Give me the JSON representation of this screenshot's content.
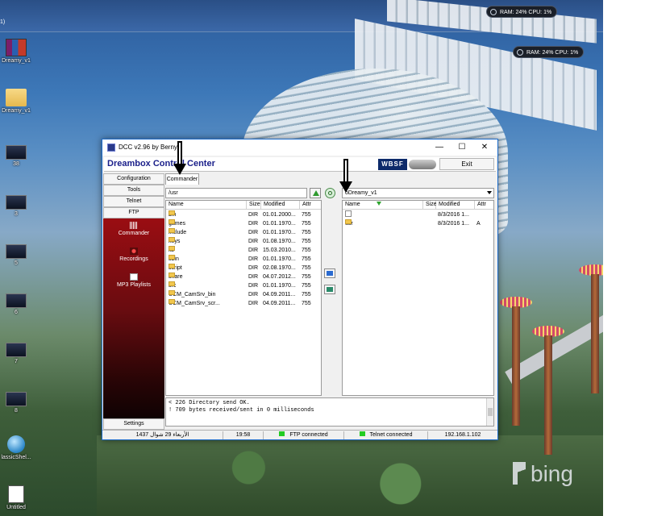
{
  "desktop": {
    "sysmon": [
      {
        "text": "RAM: 24%   CPU: 1%"
      },
      {
        "text": "RAM: 24%   CPU: 1%"
      }
    ],
    "icons": [
      {
        "label": "Dreamy_v1",
        "icon": "winrar-archive-icon"
      },
      {
        "label": "Dreamy_v1",
        "icon": "folder-icon"
      },
      {
        "label": "38",
        "icon": "screenshot-icon"
      },
      {
        "label": "3",
        "icon": "screenshot-icon"
      },
      {
        "label": "5",
        "icon": "screenshot-icon"
      },
      {
        "label": "6",
        "icon": "screenshot-icon"
      },
      {
        "label": "7",
        "icon": "screenshot-icon"
      },
      {
        "label": "8",
        "icon": "screenshot-icon"
      },
      {
        "label": "lassicShel...",
        "icon": "classic-shell-icon"
      },
      {
        "label": "Untitled",
        "icon": "document-icon"
      }
    ],
    "top_left_fragment": "1)",
    "watermark": "bing"
  },
  "window": {
    "title": "DCC v2.96 by BernyR",
    "banner_title": "Dreambox Control Center",
    "wbsf_logo": "WBSF",
    "exit_label": "Exit",
    "sidebar": {
      "buttons": [
        "Configuration",
        "Tools",
        "Telnet",
        "FTP"
      ],
      "items": [
        {
          "label": "Commander",
          "icon": "commander-icon"
        },
        {
          "label": "Recordings",
          "icon": "recordings-icon"
        },
        {
          "label": "MP3 Playlists",
          "icon": "mp3-playlist-icon"
        }
      ],
      "settings_label": "Settings"
    },
    "tab_label": "Commander",
    "left_pane": {
      "path": "/usr",
      "columns": [
        "Name",
        "Size",
        "Modified",
        "Attr"
      ],
      "rows": [
        {
          "name": "bin",
          "size": "DIR",
          "modified": "01.01.2000...",
          "attr": "755"
        },
        {
          "name": "games",
          "size": "DIR",
          "modified": "01.01.1970...",
          "attr": "755"
        },
        {
          "name": "include",
          "size": "DIR",
          "modified": "01.01.1970...",
          "attr": "755"
        },
        {
          "name": "keys",
          "size": "DIR",
          "modified": "01.08.1970...",
          "attr": "755"
        },
        {
          "name": "lib",
          "size": "DIR",
          "modified": "15.03.2010...",
          "attr": "755"
        },
        {
          "name": "sbin",
          "size": "DIR",
          "modified": "01.01.1970...",
          "attr": "755"
        },
        {
          "name": "script",
          "size": "DIR",
          "modified": "02.08.1970...",
          "attr": "755"
        },
        {
          "name": "share",
          "size": "DIR",
          "modified": "04.07.2012...",
          "attr": "755"
        },
        {
          "name": "src",
          "size": "DIR",
          "modified": "01.01.1970...",
          "attr": "755"
        },
        {
          "name": "UCM_CamSrv_bin",
          "size": "DIR",
          "modified": "04.09.2011...",
          "attr": "755"
        },
        {
          "name": "UCM_CamSrv_scr...",
          "size": "DIR",
          "modified": "04.09.2011...",
          "attr": "755"
        }
      ]
    },
    "right_pane": {
      "path": "oDreamy_v1",
      "columns": [
        "Name",
        "Size",
        "Modified",
        "Attr"
      ],
      "rows": [
        {
          "name": "..",
          "size": "",
          "modified": "8/3/2016 1...",
          "attr": ""
        },
        {
          "name": "usr",
          "size": "",
          "modified": "8/3/2016 1...",
          "attr": "A"
        }
      ]
    },
    "console": [
      "< 226 Directory send OK.",
      "! 709 bytes received/sent in 0 milliseconds"
    ],
    "status": {
      "date": "الأربعاء 29 شوال 1437",
      "time": "19:58",
      "ftp": "FTP connected",
      "telnet": "Telnet connected",
      "ip": "192.168.1.102"
    }
  }
}
